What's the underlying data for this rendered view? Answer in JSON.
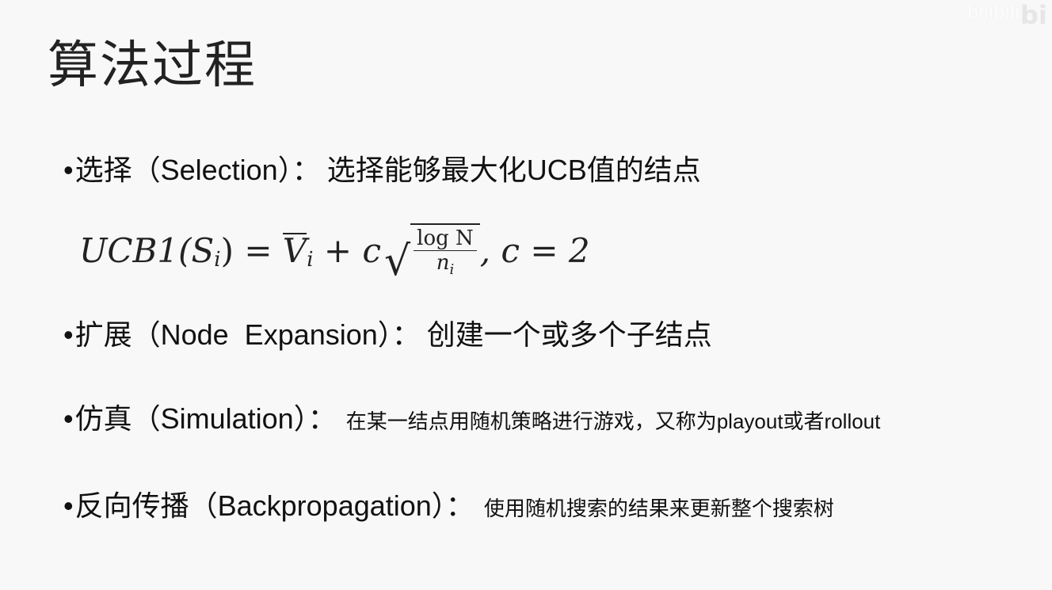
{
  "title": "算法过程",
  "watermark": "bilibili",
  "bullets": [
    {
      "dot": "•",
      "label": "选择（Selection）：",
      "desc": "选择能够最大化UCB值的结点"
    },
    {
      "dot": "•",
      "label": "扩展（Node  Expansion）：",
      "desc": "创建一个或多个子结点"
    },
    {
      "dot": "•",
      "label": "仿真（Simulation）：",
      "desc": "在某一结点用随机策略进行游戏，又称为playout或者rollout"
    },
    {
      "dot": "•",
      "label": "反向传播（Backpropagation）：",
      "desc": "使用随机搜索的结果来更新整个搜索树"
    }
  ],
  "formula": {
    "lhs": "UCB1(S",
    "lhs_sub": "i",
    "lhs_close": ") = ",
    "v": "V",
    "v_sub": "i",
    "plus": " + c",
    "sqrt_sign": "√",
    "num": "log N",
    "den": "n",
    "den_sub": "i",
    "tail": ", c = 2"
  }
}
